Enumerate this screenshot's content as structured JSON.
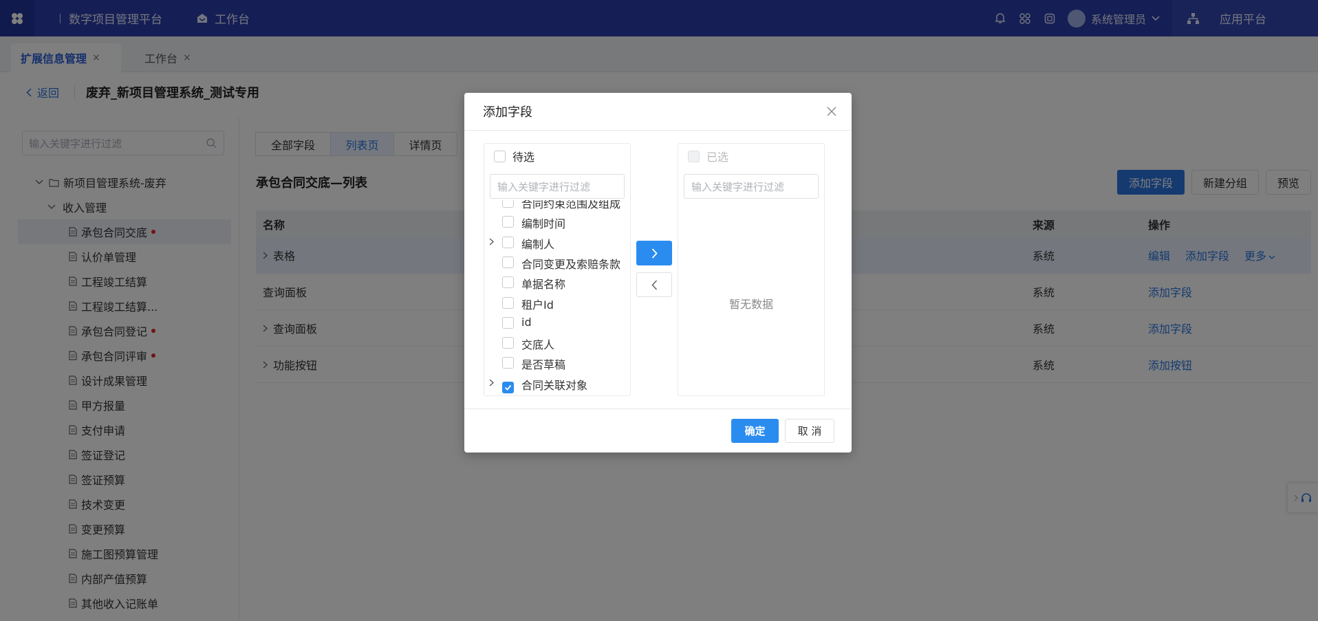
{
  "colors": {
    "topbar": "#2b3faa",
    "primary": "#2b74e0",
    "dialog_primary": "#2b8cf0",
    "dot": "#e02828"
  },
  "header": {
    "platform_title": "数字项目管理平台",
    "workspace": "工作台",
    "user": "系统管理员",
    "app_platform": "应用平台",
    "icons": [
      "bell-icon",
      "grid-icon",
      "fullscreen-icon"
    ]
  },
  "tabs": [
    {
      "label": "扩展信息管理",
      "close": "×"
    },
    {
      "label": "工作台",
      "close": "×"
    }
  ],
  "breadcrumb": {
    "back": "返回",
    "project": "废弃_新项目管理系统_测试专用"
  },
  "sidebar": {
    "search_placeholder": "输入关键字进行过滤",
    "root": "新项目管理系统-废弃",
    "group": "收入管理",
    "items": [
      {
        "label": "承包合同交底",
        "dot": true,
        "selected": true
      },
      {
        "label": "认价单管理"
      },
      {
        "label": "工程竣工结算"
      },
      {
        "label": "工程竣工结算..."
      },
      {
        "label": "承包合同登记",
        "dot": true
      },
      {
        "label": "承包合同评审",
        "dot": true
      },
      {
        "label": "设计成果管理"
      },
      {
        "label": "甲方报量"
      },
      {
        "label": "支付申请"
      },
      {
        "label": "签证登记"
      },
      {
        "label": "签证预算"
      },
      {
        "label": "技术变更"
      },
      {
        "label": "变更预算"
      },
      {
        "label": "施工图预算管理"
      },
      {
        "label": "内部产值预算"
      },
      {
        "label": "其他收入记账单"
      }
    ]
  },
  "main": {
    "seg_tabs": [
      "全部字段",
      "列表页",
      "详情页"
    ],
    "table_title": "承包合同交底—列表",
    "buttons": {
      "add_field": "添加字段",
      "new_group": "新建分组",
      "preview": "预览"
    },
    "columns": {
      "name": "名称",
      "source": "来源",
      "ops": "操作"
    },
    "rows": [
      {
        "name": "表格",
        "source": "系统",
        "ops": [
          "编辑",
          "添加字段",
          "更多"
        ]
      },
      {
        "name": "查询面板",
        "source": "系统",
        "ops": [
          "添加字段"
        ]
      },
      {
        "name": "查询面板",
        "source": "系统",
        "ops": [
          "添加字段"
        ]
      },
      {
        "name": "功能按钮",
        "source": "系统",
        "ops": [
          "添加按钮"
        ]
      }
    ]
  },
  "dialog": {
    "title": "添加字段",
    "left_title": "待选",
    "right_title": "已选",
    "filter_placeholder": "输入关键字进行过滤",
    "empty_text": "暂无数据",
    "items": [
      {
        "label": "合同约束范围及组成"
      },
      {
        "label": "编制时间"
      },
      {
        "label": "编制人",
        "expandable": true
      },
      {
        "label": "合同变更及索赔条款"
      },
      {
        "label": "单据名称"
      },
      {
        "label": "租户Id"
      },
      {
        "label": "id"
      },
      {
        "label": "交底人"
      },
      {
        "label": "是否草稿"
      },
      {
        "label": "合同关联对象",
        "expandable": true,
        "checked": true
      }
    ],
    "confirm": "确定",
    "cancel": "取 消"
  }
}
